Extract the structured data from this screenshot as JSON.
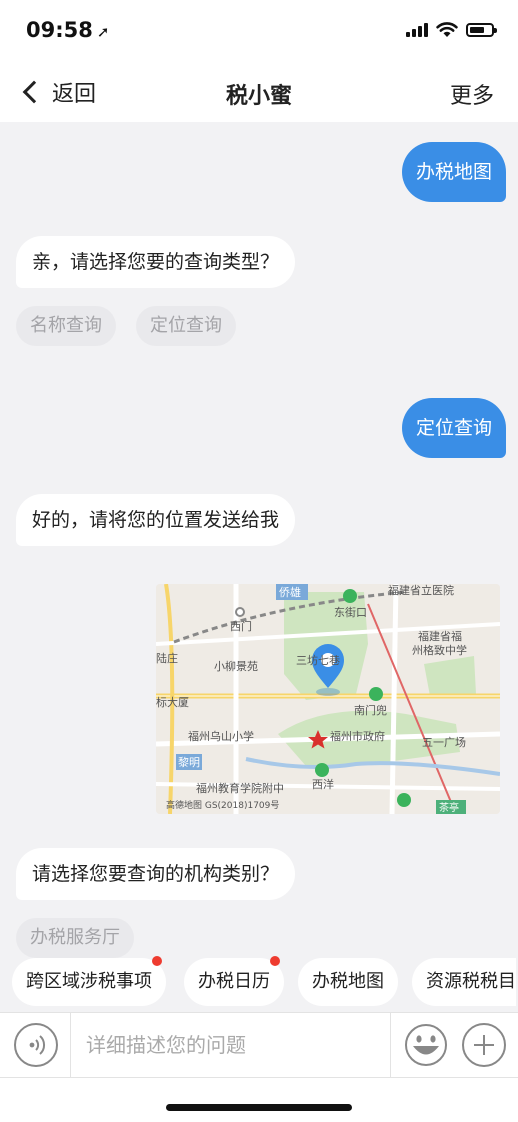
{
  "status_bar": {
    "time": "09:58"
  },
  "nav": {
    "back_label": "返回",
    "title": "税小蜜",
    "more_label": "更多"
  },
  "messages": {
    "user_1": "办税地图",
    "bot_1": "亲，请选择您要的查询类型？",
    "bot_1_options": [
      "名称查询",
      "定位查询"
    ],
    "user_2": "定位查询",
    "bot_2": "好的，请将您的位置发送给我",
    "bot_3": "请选择您要查询的机构类别？",
    "bot_3_options": [
      "办税服务厅"
    ]
  },
  "map": {
    "labels": {
      "a": "福建省立医院",
      "b": "侨雄",
      "c": "东街口",
      "d": "西门",
      "e": "福建省福",
      "f": "州格致中学",
      "g": "陆庄",
      "h": "小柳景苑",
      "i": "三坊七巷",
      "j": "南门兜",
      "k": "标大厦",
      "l": "福州乌山小学",
      "m": "福州市政府",
      "n": "五一广场",
      "o": "黎明",
      "p": "西洋",
      "q": "福州教育学院附中",
      "r": "高德地图 GS(2018)1709号",
      "s": "茶亭",
      "t": "茶亭"
    }
  },
  "quick_actions": [
    {
      "label": "跨区域涉税事项",
      "dot": true
    },
    {
      "label": "办税日历",
      "dot": true
    },
    {
      "label": "办税地图",
      "dot": false
    },
    {
      "label": "资源税税目",
      "dot": false
    }
  ],
  "input": {
    "placeholder": "详细描述您的问题"
  },
  "colors": {
    "accent": "#3a8ee6",
    "badge": "#ee3b2f"
  }
}
